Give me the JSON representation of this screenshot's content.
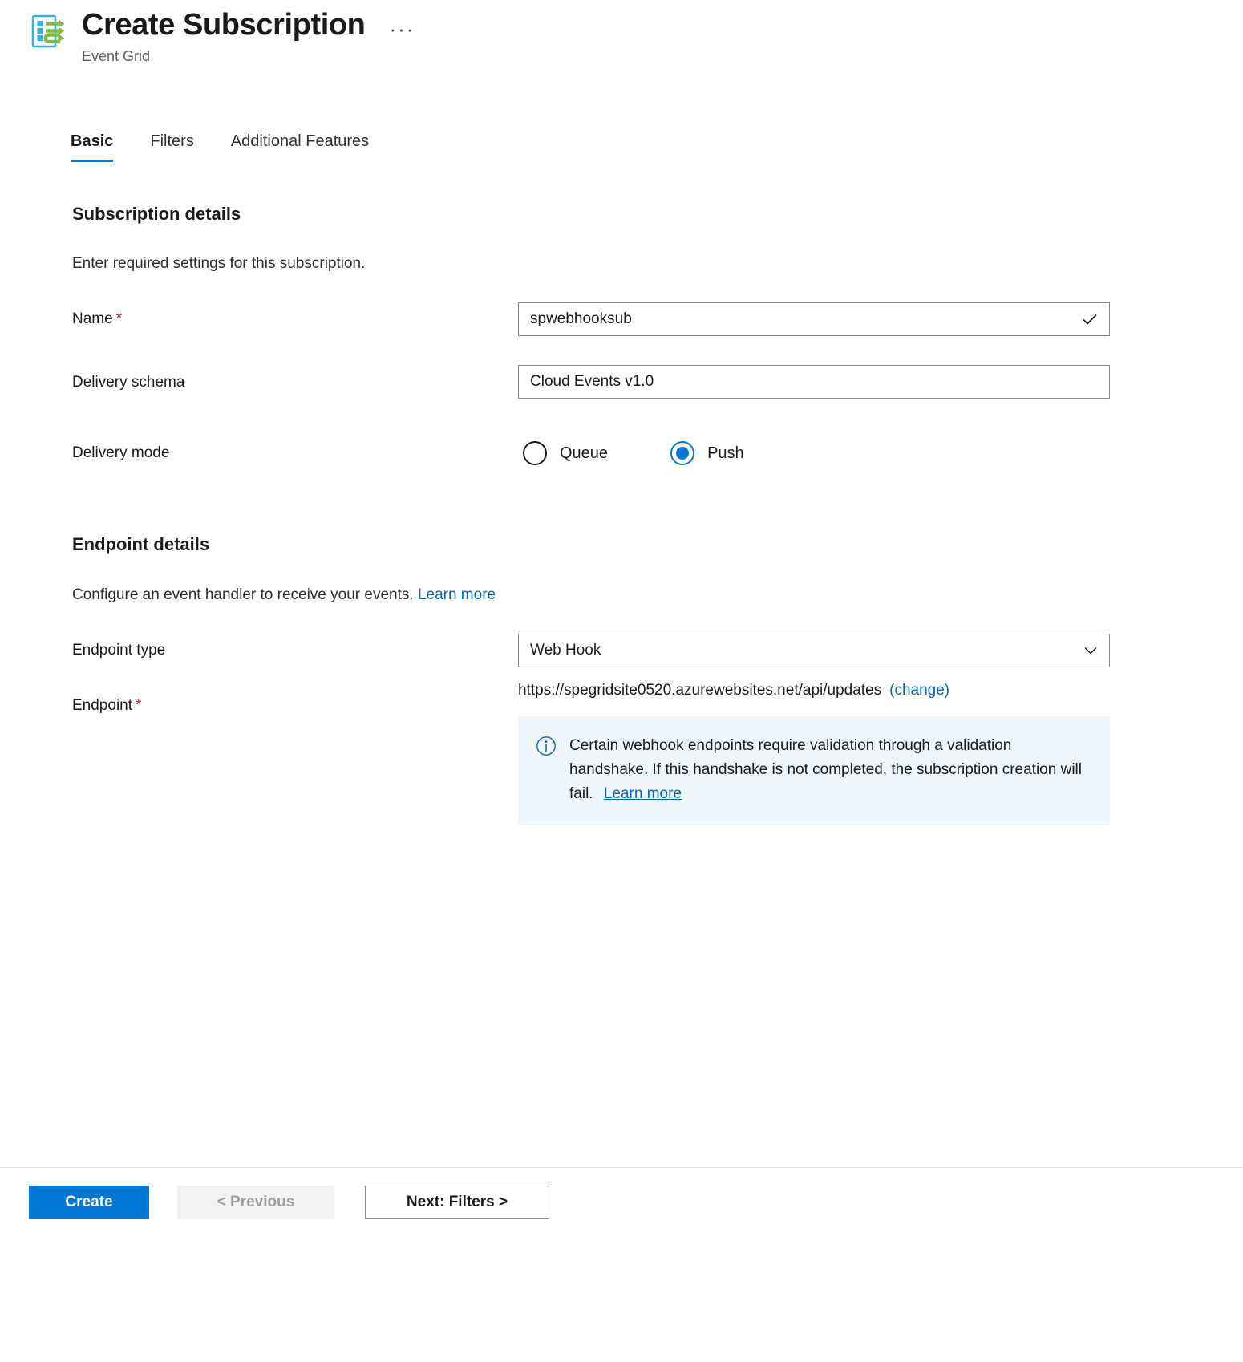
{
  "header": {
    "icon": "event-grid-icon",
    "title": "Create Subscription",
    "subtitle": "Event Grid",
    "more_label": "···"
  },
  "tabs": [
    {
      "label": "Basic",
      "active": true
    },
    {
      "label": "Filters",
      "active": false
    },
    {
      "label": "Additional Features",
      "active": false
    }
  ],
  "subscription_details": {
    "heading": "Subscription details",
    "description": "Enter required settings for this subscription.",
    "name": {
      "label": "Name",
      "required_marker": "*",
      "value": "spwebhooksub",
      "placeholder": "",
      "validation_icon": "checkmark-icon"
    },
    "delivery_schema": {
      "label": "Delivery schema",
      "value": "Cloud Events v1.0"
    },
    "delivery_mode": {
      "label": "Delivery mode",
      "options": [
        {
          "label": "Queue",
          "selected": false
        },
        {
          "label": "Push",
          "selected": true
        }
      ],
      "selected": "Push"
    }
  },
  "endpoint_details": {
    "heading": "Endpoint details",
    "description": "Configure an event handler to receive your events.",
    "description_link": "Learn more",
    "endpoint_type": {
      "label": "Endpoint type",
      "value": "Web Hook",
      "dropdown_icon": "chevron-down-icon"
    },
    "endpoint": {
      "label": "Endpoint",
      "required_marker": "*",
      "url": "https://spegridsite0520.azurewebsites.net/api/updates",
      "change_link": "(change)"
    },
    "info": {
      "icon": "info-circle-icon",
      "text": "Certain webhook endpoints require validation through a validation handshake. If this handshake is not completed, the subscription creation will fail.",
      "link": "Learn more"
    }
  },
  "footer": {
    "create_label": "Create",
    "previous_label": "< Previous",
    "next_label": "Next: Filters >"
  },
  "colors": {
    "accent": "#0078d4",
    "link": "#0067b8",
    "required": "#a4262c",
    "info_bg": "#eff6fc",
    "border": "#8a8886",
    "icon_blue": "#32b0e7",
    "icon_green": "#7fba42"
  }
}
